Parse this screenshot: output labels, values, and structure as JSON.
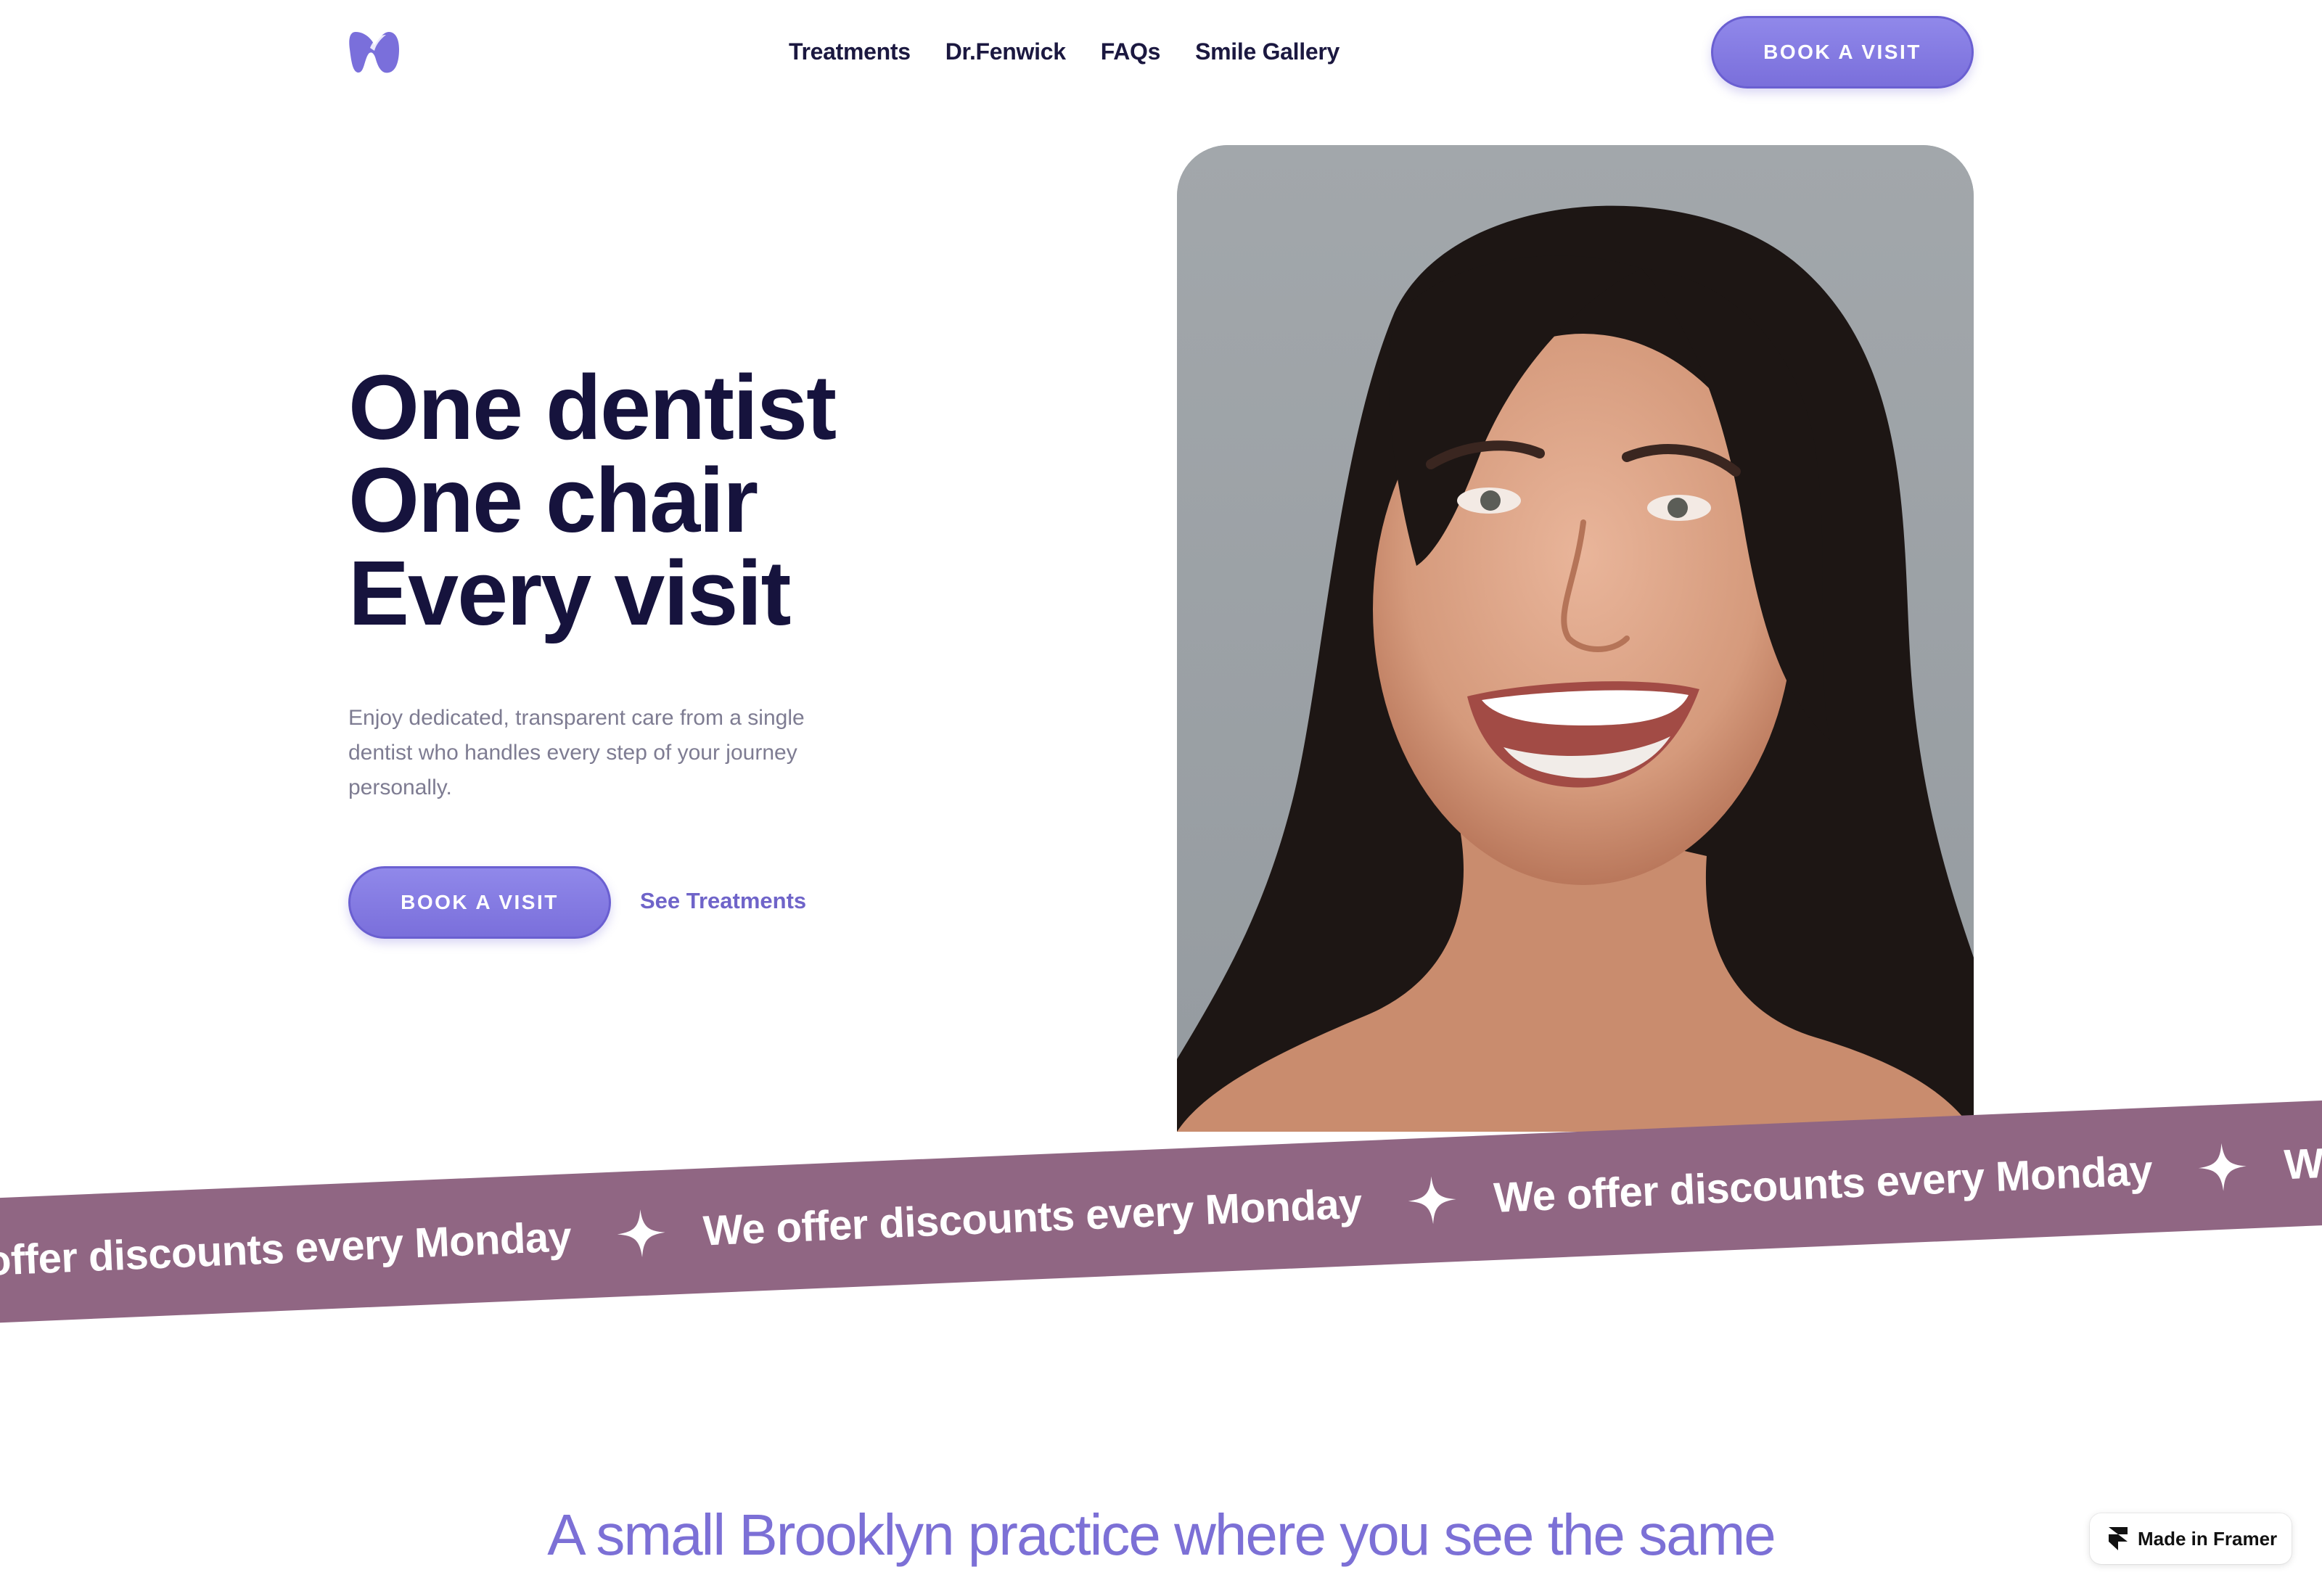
{
  "header": {
    "logo_icon": "tooth-logo-icon",
    "nav": [
      "Treatments",
      "Dr.Fenwick",
      "FAQs",
      "Smile Gallery"
    ],
    "cta_label": "BOOK A VISIT"
  },
  "hero": {
    "title_lines": [
      "One dentist",
      "One chair",
      "Every visit"
    ],
    "subtitle": "Enjoy dedicated, transparent care from a single dentist who handles every step of your journey personally.",
    "cta_label": "BOOK A VISIT",
    "link_label": "See Treatments",
    "photo_icon": "smiling-woman-portrait"
  },
  "marquee": {
    "items": [
      "We offer discounts every Monday",
      "We offer discounts every Monday",
      "We offer discounts every Monday",
      "We offer discounts every Monday"
    ],
    "separator_icon": "sparkle-star-icon"
  },
  "section": {
    "heading": "A small Brooklyn practice where you see the same"
  },
  "badge": {
    "label": "Made in Framer",
    "icon": "framer-logo-icon"
  },
  "colors": {
    "accent": "#7a6fdb",
    "heading": "#16133d",
    "band": "#906683",
    "section_heading": "#7c70d6"
  }
}
